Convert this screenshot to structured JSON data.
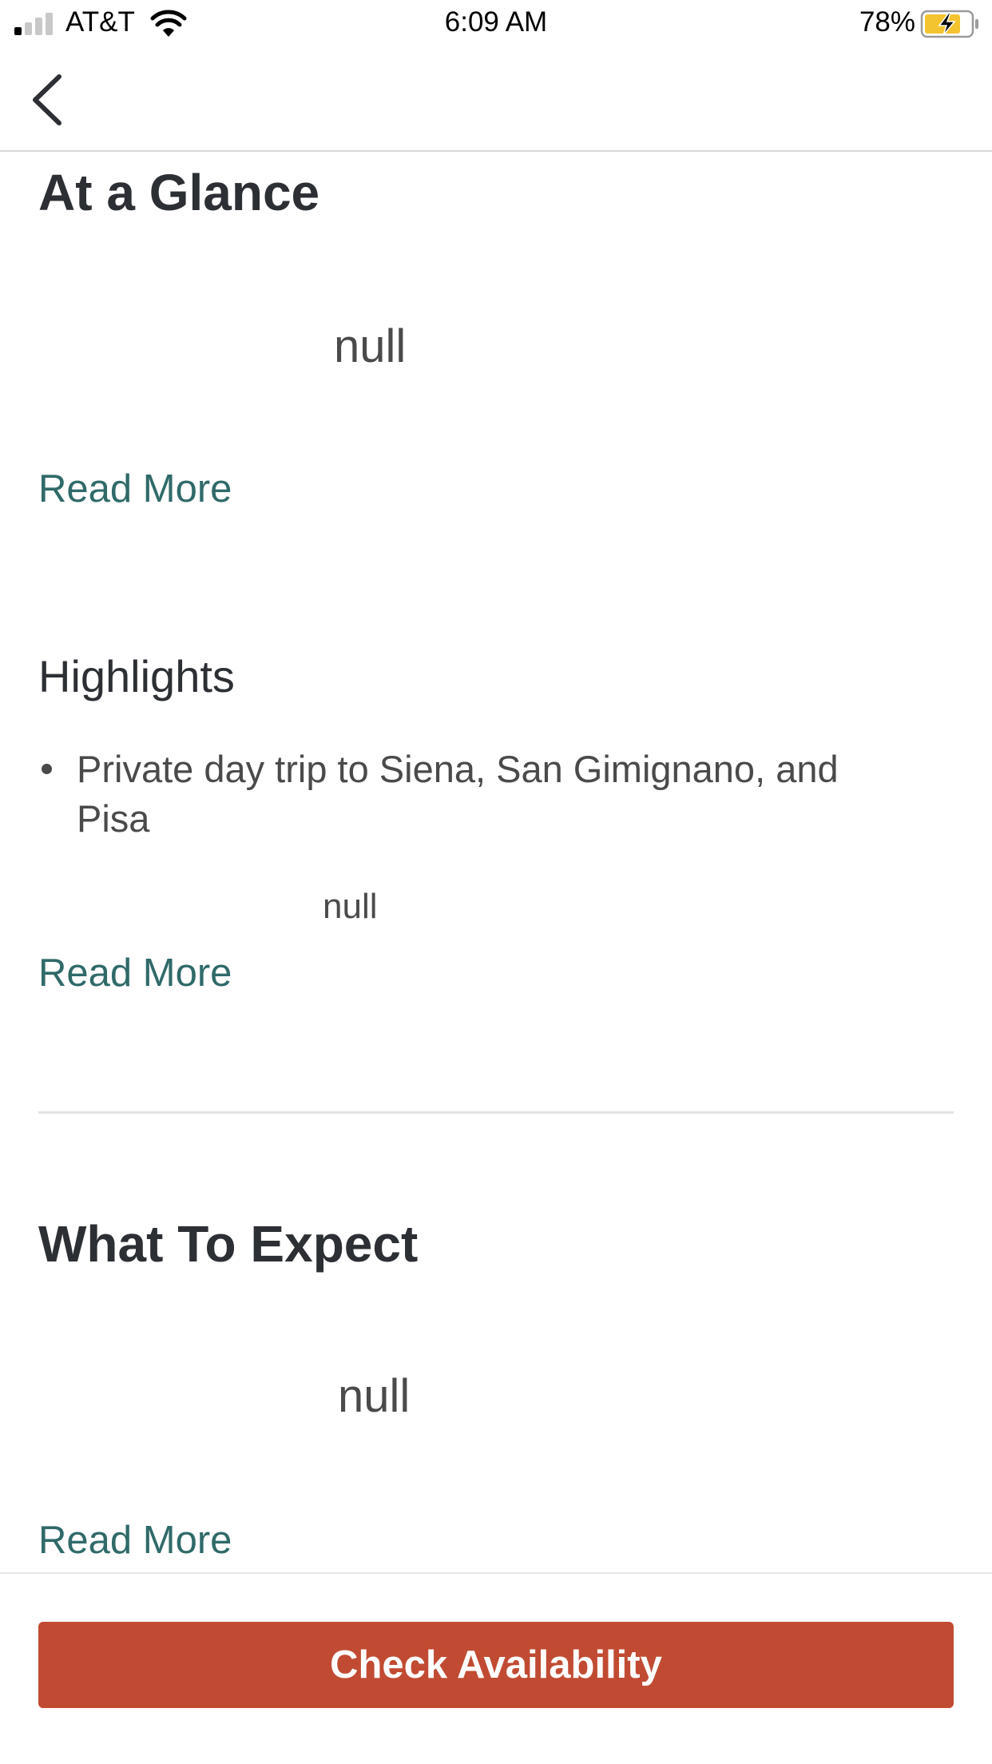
{
  "status_bar": {
    "carrier": "AT&T",
    "time": "6:09 AM",
    "battery_percent": "78%",
    "battery_level": 0.78,
    "battery_color": "#f4c430"
  },
  "nav": {
    "back_icon": "chevron-left-icon"
  },
  "at_a_glance": {
    "title": "At a Glance",
    "body": "null",
    "read_more": "Read More"
  },
  "highlights": {
    "title": "Highlights",
    "items": [
      "Private day trip to Siena, San Gimignano, and Pisa"
    ],
    "body": "null",
    "read_more": "Read More"
  },
  "what_to_expect": {
    "title": "What To Expect",
    "body": "null",
    "read_more": "Read More"
  },
  "footer": {
    "cta_label": "Check Availability",
    "cta_color": "#c14b32"
  },
  "colors": {
    "link": "#2f6a69",
    "text": "#2c2f33"
  }
}
